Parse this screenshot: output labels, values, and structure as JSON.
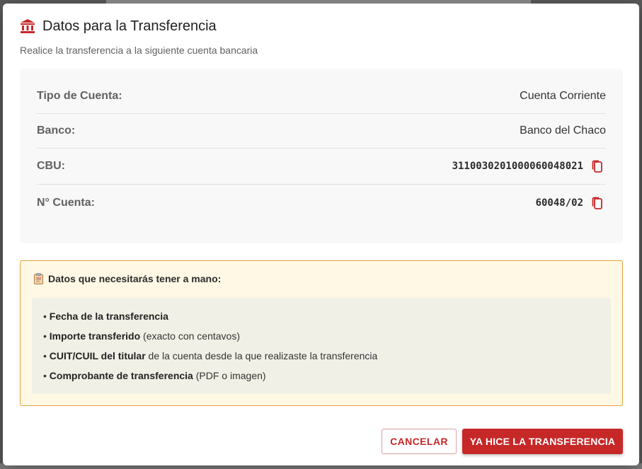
{
  "dialog": {
    "title": "Datos para la Transferencia",
    "subtitle": "Realice la transferencia a la siguiente cuenta bancaria",
    "title_icon": "bank-icon"
  },
  "account": {
    "rows": [
      {
        "label": "Tipo de Cuenta:",
        "value": "Cuenta Corriente",
        "copyable": false
      },
      {
        "label": "Banco:",
        "value": "Banco del Chaco",
        "copyable": false
      },
      {
        "label": "CBU:",
        "value": "3110030201000060048021",
        "copyable": true
      },
      {
        "label": "N° Cuenta:",
        "value": "60048/02",
        "copyable": true
      }
    ]
  },
  "info": {
    "heading": "Datos que necesitarás tener a mano:",
    "heading_icon": "clipboard-icon",
    "items": [
      {
        "bold": "Fecha de la transferencia",
        "rest": ""
      },
      {
        "bold": "Importe transferido",
        "rest": " (exacto con centavos)"
      },
      {
        "bold": "CUIT/CUIL del titular",
        "rest": " de la cuenta desde la que realizaste la transferencia"
      },
      {
        "bold": "Comprobante de transferencia",
        "rest": " (PDF o imagen)"
      }
    ],
    "bullet": "•"
  },
  "actions": {
    "cancel_label": "CANCELAR",
    "confirm_label": "YA HICE LA TRANSFERENCIA"
  },
  "colors": {
    "accent": "#c62828",
    "info_border": "#e6a23c",
    "info_bg": "#fff8e5"
  }
}
